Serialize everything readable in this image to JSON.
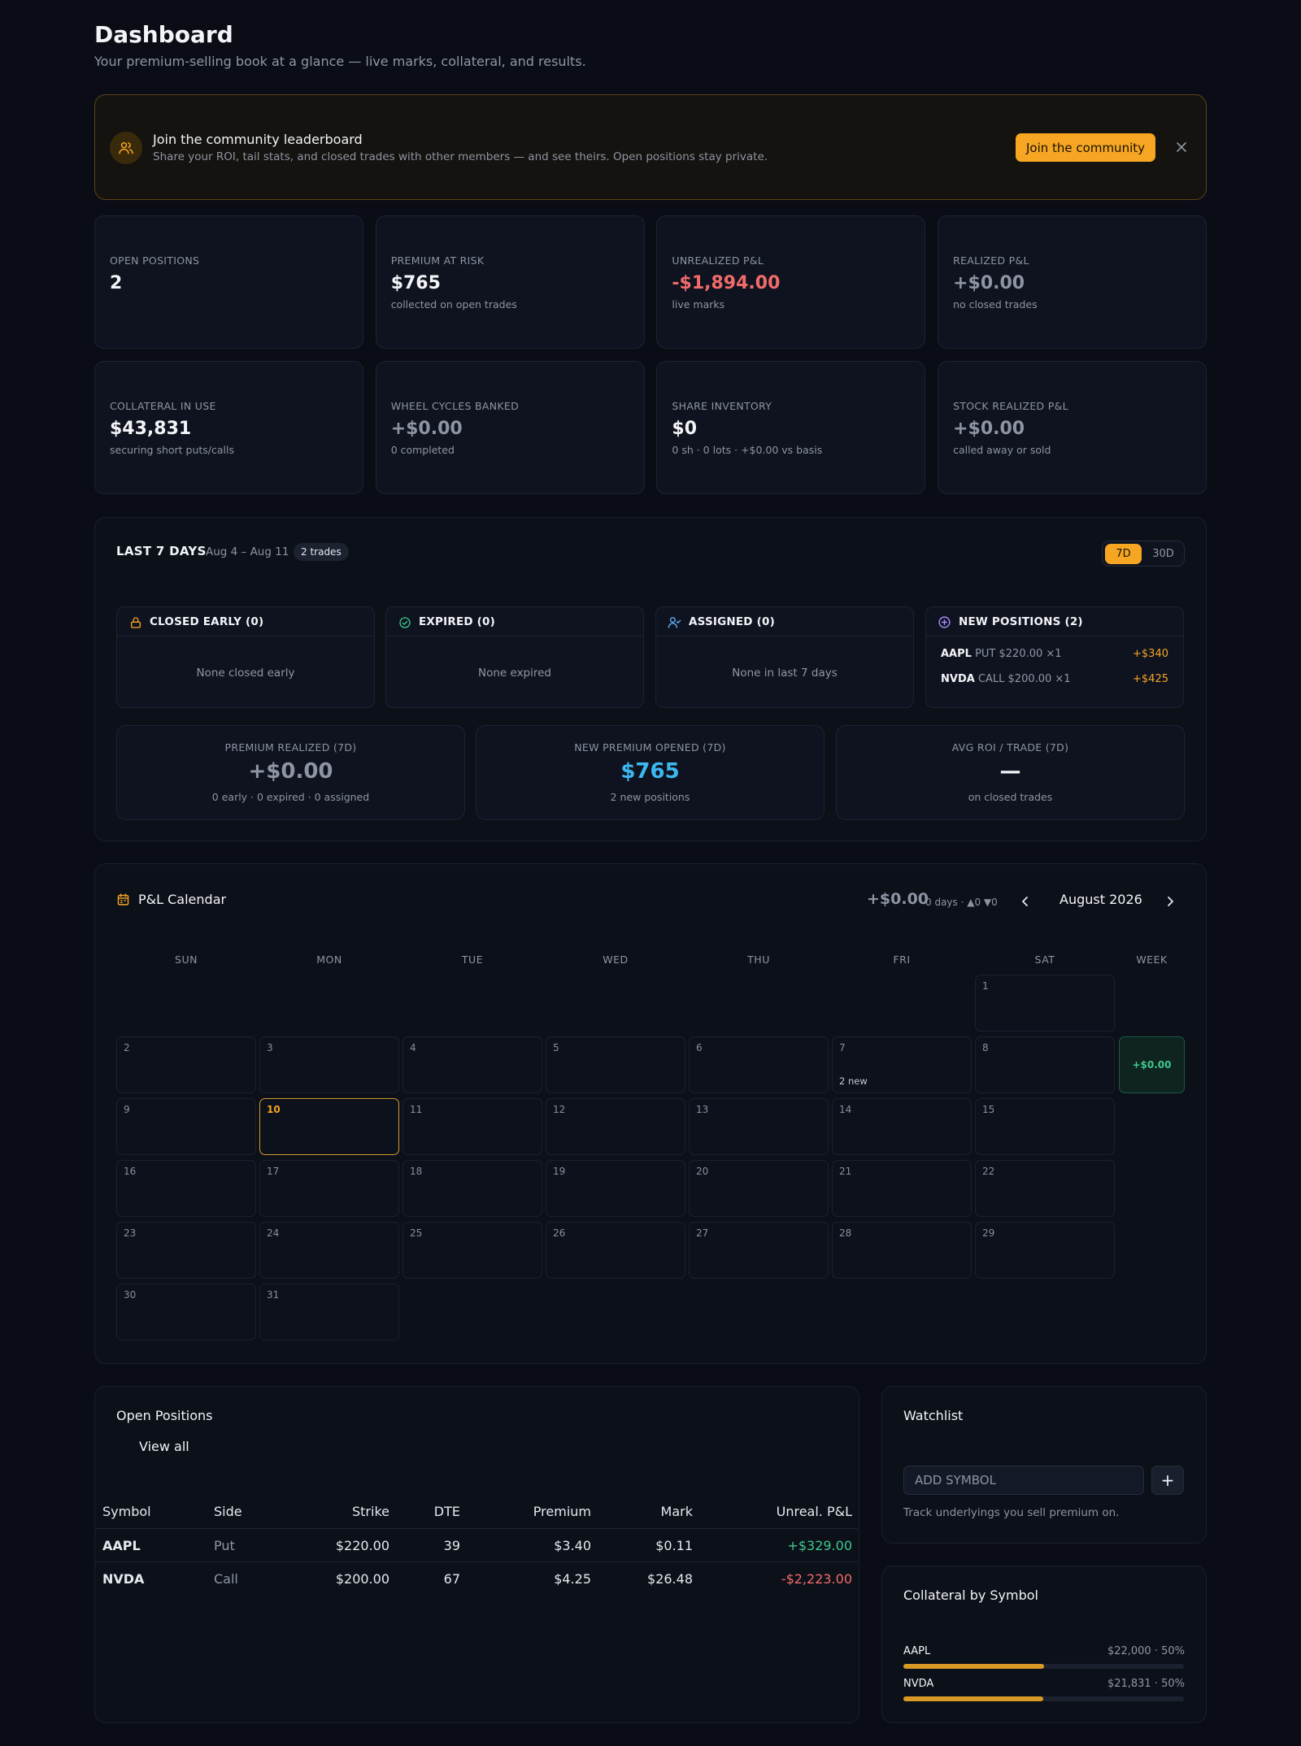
{
  "header": {
    "title": "Dashboard",
    "subtitle": "Your premium-selling book at a glance — live marks, collateral, and results."
  },
  "banner": {
    "icon": "users-icon",
    "title": "Join the community leaderboard",
    "text": "Share your ROI, tail stats, and closed trades with other members — and see theirs. Open positions stay private.",
    "button": "Join the community",
    "close_icon": "close-icon"
  },
  "stats": [
    {
      "label": "OPEN POSITIONS",
      "value": "2",
      "sub": "",
      "tone": "default"
    },
    {
      "label": "PREMIUM AT RISK",
      "value": "$765",
      "sub": "collected on open trades",
      "tone": "default"
    },
    {
      "label": "UNREALIZED P&L",
      "value": "-$1,894.00",
      "sub": "live marks",
      "tone": "negative"
    },
    {
      "label": "REALIZED P&L",
      "value": "+$0.00",
      "sub": "no closed trades",
      "tone": "muted"
    },
    {
      "label": "COLLATERAL IN USE",
      "value": "$43,831",
      "sub": "securing short puts/calls",
      "tone": "default"
    },
    {
      "label": "WHEEL CYCLES BANKED",
      "value": "+$0.00",
      "sub": "0 completed",
      "tone": "muted"
    },
    {
      "label": "SHARE INVENTORY",
      "value": "$0",
      "sub": "0 sh · 0 lots · +$0.00 vs basis",
      "tone": "default"
    },
    {
      "label": "STOCK REALIZED P&L",
      "value": "+$0.00",
      "sub": "called away or sold",
      "tone": "muted"
    }
  ],
  "last7": {
    "title": "LAST 7 DAYS",
    "range": "Aug 4 – Aug 11",
    "badge": "2 trades",
    "toggle": [
      "7D",
      "30D"
    ],
    "groups": [
      {
        "icon": "lock-icon",
        "title": "CLOSED EARLY (0)",
        "empty": "None closed early"
      },
      {
        "icon": "check-circle-icon",
        "title": "EXPIRED (0)",
        "empty": "None expired"
      },
      {
        "icon": "user-check-icon",
        "title": "ASSIGNED (0)",
        "empty": "None in last 7 days"
      },
      {
        "icon": "plus-circle-icon",
        "title": "NEW POSITIONS (2)",
        "empty": ""
      }
    ],
    "new_positions": [
      {
        "symbol": "AAPL",
        "detail": "PUT $220.00 ×1",
        "amount": "+$340"
      },
      {
        "symbol": "NVDA",
        "detail": "CALL $200.00 ×1",
        "amount": "+$425"
      }
    ],
    "summary": [
      {
        "label": "PREMIUM REALIZED (7D)",
        "value": "+$0.00",
        "sub": "0 early · 0 expired · 0 assigned",
        "color": "#8e94a3"
      },
      {
        "label": "NEW PREMIUM OPENED (7D)",
        "value": "$765",
        "sub": "2 new positions",
        "color": "#3db7f0"
      },
      {
        "label": "AVG ROI / TRADE (7D)",
        "value": "—",
        "sub": "on closed trades",
        "color": "#f3f4f7"
      }
    ]
  },
  "calendar": {
    "title": "P&L Calendar",
    "icon": "calendar-icon",
    "total": "+$0.00",
    "meta": "0 days · ▲0 ▼0",
    "month": "August 2026",
    "prev_icon": "chevron-left-icon",
    "next_icon": "chevron-right-icon",
    "weekdays": [
      "SUN",
      "MON",
      "TUE",
      "WED",
      "THU",
      "FRI",
      "SAT"
    ],
    "week_label": "WEEK",
    "today": "10",
    "notes": {
      "7": "2 new"
    },
    "week_totals": [
      "+$0.00"
    ]
  },
  "open_positions": {
    "title": "Open Positions",
    "view_all": "View all",
    "columns": [
      "Symbol",
      "Side",
      "Strike",
      "DTE",
      "Premium",
      "Mark",
      "Unreal. P&L"
    ],
    "rows": [
      {
        "symbol": "AAPL",
        "side": "Put",
        "strike": "$220.00",
        "dte": "39",
        "premium": "$3.40",
        "mark": "$0.11",
        "pnl": "+$329.00",
        "tone": "pos"
      },
      {
        "symbol": "NVDA",
        "side": "Call",
        "strike": "$200.00",
        "dte": "67",
        "premium": "$4.25",
        "mark": "$26.48",
        "pnl": "-$2,223.00",
        "tone": "neg"
      }
    ]
  },
  "watchlist": {
    "title": "Watchlist",
    "placeholder": "ADD SYMBOL",
    "add_label": "+",
    "help": "Track underlyings you sell premium on."
  },
  "collateral": {
    "title": "Collateral by Symbol",
    "items": [
      {
        "symbol": "AAPL",
        "value": "$22,000 · 50%",
        "fraction": 0.5
      },
      {
        "symbol": "NVDA",
        "value": "$21,831 · 50%",
        "fraction": 0.498
      }
    ]
  }
}
